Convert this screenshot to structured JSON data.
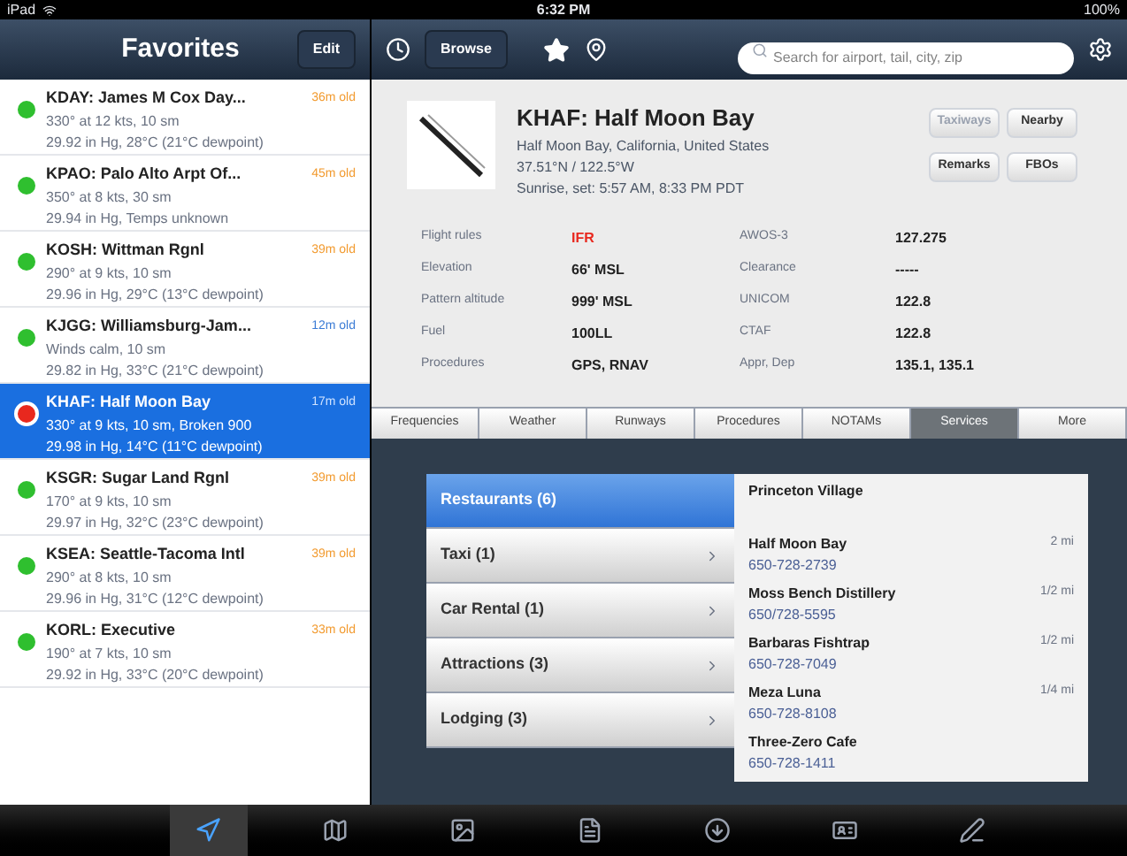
{
  "status_bar": {
    "device": "iPad",
    "time": "6:32 PM",
    "battery": "100%"
  },
  "favorites": {
    "title": "Favorites",
    "edit": "Edit",
    "items": [
      {
        "name": "KDAY: James M Cox Day...",
        "line1": "330° at 12 kts, 10 sm",
        "line2": "29.92 in Hg, 28°C (21°C dewpoint)",
        "age": "36m old",
        "age_fresh": false,
        "color": "#2fbf2f",
        "selected": false
      },
      {
        "name": "KPAO: Palo Alto Arpt Of...",
        "line1": "350° at 8 kts, 30 sm",
        "line2": "29.94 in Hg, Temps unknown",
        "age": "45m old",
        "age_fresh": false,
        "color": "#2fbf2f",
        "selected": false
      },
      {
        "name": "KOSH: Wittman Rgnl",
        "line1": "290° at 9 kts, 10 sm",
        "line2": "29.96 in Hg, 29°C (13°C dewpoint)",
        "age": "39m old",
        "age_fresh": false,
        "color": "#2fbf2f",
        "selected": false
      },
      {
        "name": "KJGG: Williamsburg-Jam...",
        "line1": "Winds calm, 10 sm",
        "line2": "29.82 in Hg, 33°C (21°C dewpoint)",
        "age": "12m old",
        "age_fresh": true,
        "color": "#2fbf2f",
        "selected": false
      },
      {
        "name": "KHAF: Half Moon Bay",
        "line1": "330° at 9 kts, 10 sm, Broken 900",
        "line2": "29.98 in Hg, 14°C (11°C dewpoint)",
        "age": "17m old",
        "age_fresh": true,
        "color": "#e8281e",
        "selected": true
      },
      {
        "name": "KSGR: Sugar Land Rgnl",
        "line1": "170° at 9 kts, 10 sm",
        "line2": "29.97 in Hg, 32°C (23°C dewpoint)",
        "age": "39m old",
        "age_fresh": false,
        "color": "#2fbf2f",
        "selected": false
      },
      {
        "name": "KSEA: Seattle-Tacoma Intl",
        "line1": "290° at 8 kts, 10 sm",
        "line2": "29.96 in Hg, 31°C (12°C dewpoint)",
        "age": "39m old",
        "age_fresh": false,
        "color": "#2fbf2f",
        "selected": false
      },
      {
        "name": "KORL: Executive",
        "line1": "190° at 7 kts, 10 sm",
        "line2": "29.92 in Hg, 33°C (20°C dewpoint)",
        "age": "33m old",
        "age_fresh": false,
        "color": "#2fbf2f",
        "selected": false
      }
    ]
  },
  "toolbar": {
    "browse": "Browse",
    "search_placeholder": "Search for airport, tail, city, zip"
  },
  "airport": {
    "title": "KHAF: Half Moon Bay",
    "location": "Half Moon Bay, California, United States",
    "coords": "37.51°N / 122.5°W",
    "sun": "Sunrise, set: 5:57 AM, 8:33 PM PDT",
    "buttons": [
      {
        "label": "Taxiways",
        "disabled": true
      },
      {
        "label": "Nearby",
        "disabled": false
      },
      {
        "label": "Remarks",
        "disabled": false
      },
      {
        "label": "FBOs",
        "disabled": false
      }
    ],
    "details": [
      {
        "label": "Flight rules",
        "value": "IFR",
        "alert": true,
        "label_2": "AWOS-3",
        "value_2": "127.275"
      },
      {
        "label": "Elevation",
        "value": "66' MSL",
        "alert": false,
        "label_2": "Clearance",
        "value_2": "-----"
      },
      {
        "label": "Pattern altitude",
        "value": "999' MSL",
        "alert": false,
        "label_2": "UNICOM",
        "value_2": "122.8"
      },
      {
        "label": "Fuel",
        "value": "100LL",
        "alert": false,
        "label_2": "CTAF",
        "value_2": "122.8"
      },
      {
        "label": "Procedures",
        "value": "GPS, RNAV",
        "alert": false,
        "label_2": "Appr, Dep",
        "value_2": "135.1, 135.1"
      }
    ]
  },
  "tabs": [
    {
      "label": "Frequencies",
      "selected": false
    },
    {
      "label": "Weather",
      "selected": false
    },
    {
      "label": "Runways",
      "selected": false
    },
    {
      "label": "Procedures",
      "selected": false
    },
    {
      "label": "NOTAMs",
      "selected": false
    },
    {
      "label": "Services",
      "selected": true
    },
    {
      "label": "More",
      "selected": false
    }
  ],
  "services": {
    "categories": [
      {
        "label": "Restaurants (6)",
        "selected": true
      },
      {
        "label": "Taxi (1)",
        "selected": false
      },
      {
        "label": "Car Rental (1)",
        "selected": false
      },
      {
        "label": "Attractions (3)",
        "selected": false
      },
      {
        "label": "Lodging (3)",
        "selected": false
      }
    ],
    "places": [
      {
        "name": "Princeton Village"
      },
      {
        "name": "Half Moon Bay",
        "phone": "650-728-2739",
        "distance": "2 mi"
      },
      {
        "name": "Moss Bench Distillery",
        "phone": "650/728-5595",
        "distance": "1/2 mi"
      },
      {
        "name": "Barbaras Fishtrap",
        "phone": "650-728-7049",
        "distance": "1/2 mi"
      },
      {
        "name": "Meza Luna",
        "phone": "650-728-8108",
        "distance": "1/4 mi"
      },
      {
        "name": "Three-Zero Cafe",
        "phone": "650-728-1411"
      }
    ]
  },
  "tab_bar": [
    {
      "selected": true
    },
    {
      "selected": false
    },
    {
      "selected": false
    },
    {
      "selected": false
    },
    {
      "selected": false
    },
    {
      "selected": false
    },
    {
      "selected": false
    }
  ]
}
